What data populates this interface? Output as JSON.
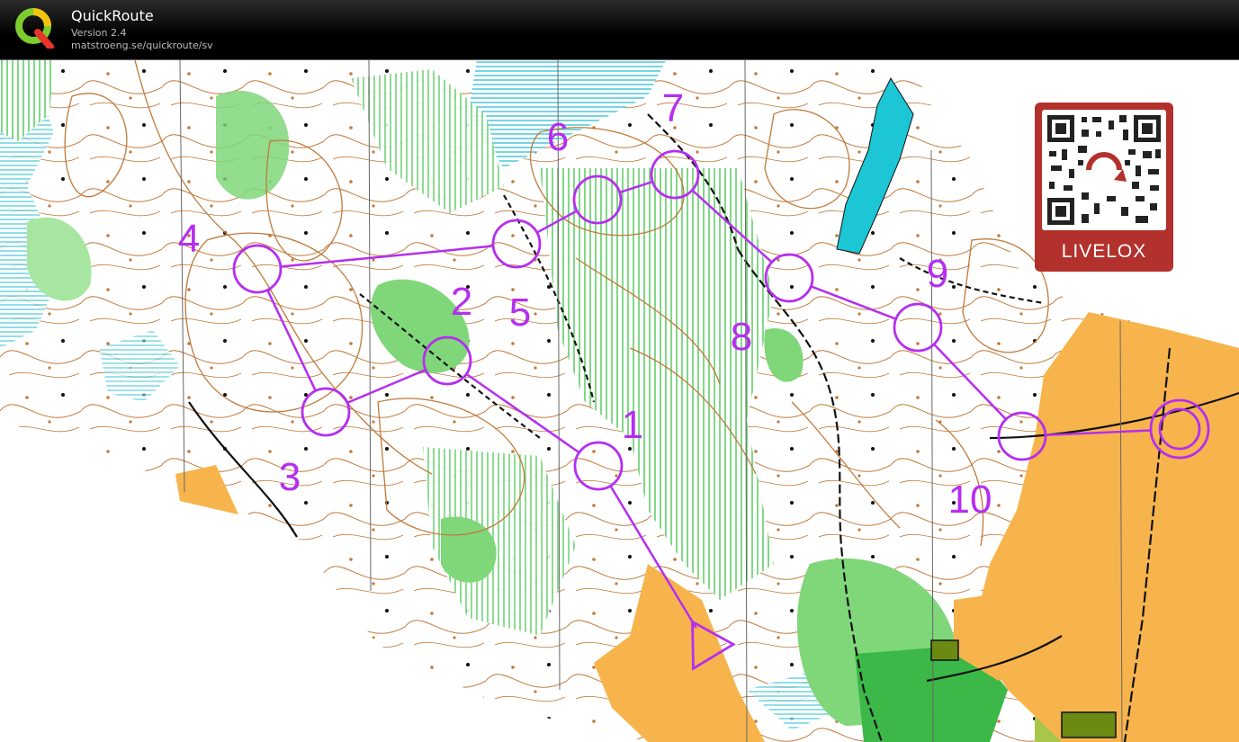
{
  "window": {
    "app_name": "QuickRoute",
    "version": "Version 2.4",
    "url": "matstroeng.se/quickroute/sv",
    "logo_icon": "quickroute-q-logo-icon"
  },
  "course": {
    "color": "#b52ef0",
    "start_icon": "start-triangle-icon",
    "finish_icon": "finish-double-circle-icon",
    "control_icon": "control-circle-icon",
    "controls": [
      {
        "number": "1"
      },
      {
        "number": "2"
      },
      {
        "number": "3"
      },
      {
        "number": "4"
      },
      {
        "number": "5"
      },
      {
        "number": "6"
      },
      {
        "number": "7"
      },
      {
        "number": "8"
      },
      {
        "number": "9"
      },
      {
        "number": "10"
      }
    ]
  },
  "badge": {
    "label": "LIVELOX",
    "icon": "livelox-qr-code-icon",
    "color": "#b3312c"
  },
  "map_colors": {
    "open_land": "#f7b44c",
    "vegetation": "#7fd77a",
    "marsh": "#46c8d8",
    "water": "#1cc6d4",
    "contour": "#c0793a"
  }
}
